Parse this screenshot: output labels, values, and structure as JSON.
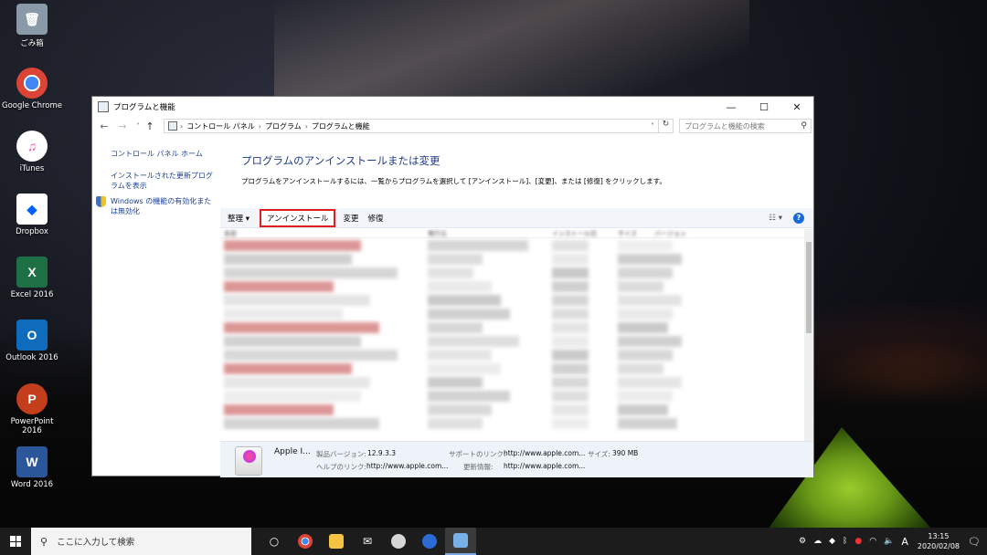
{
  "desktop": {
    "icons": [
      {
        "label": "ごみ箱",
        "color": "#7a8a9a",
        "glyph": "🗑"
      },
      {
        "label": "Google Chrome",
        "color": "#db4437",
        "glyph": "◉"
      },
      {
        "label": "iTunes",
        "color": "#ec4fa0",
        "glyph": "♫"
      },
      {
        "label": "Dropbox",
        "color": "#ffffff",
        "glyph": "◆"
      },
      {
        "label": "Excel 2016",
        "color": "#1d7044",
        "glyph": "X"
      },
      {
        "label": "Outlook 2016",
        "color": "#0f6cbd",
        "glyph": "O"
      },
      {
        "label": "PowerPoint 2016",
        "color": "#c43e1c",
        "glyph": "P"
      },
      {
        "label": "Word 2016",
        "color": "#2b579a",
        "glyph": "W"
      }
    ]
  },
  "window": {
    "title": "プログラムと機能",
    "minimize": "—",
    "maximize": "☐",
    "close": "✕",
    "nav": {
      "back": "←",
      "forward": "→",
      "dropdown": "˅",
      "up": "↑"
    },
    "breadcrumb": [
      "コントロール パネル",
      "プログラム",
      "プログラムと機能"
    ],
    "refresh": "↻",
    "search_placeholder": "プログラムと機能の検索",
    "left_links": {
      "home": "コントロール パネル ホーム",
      "updates": "インストールされた更新プログラムを表示",
      "features": "Windows の機能の有効化または無効化"
    },
    "heading": "プログラムのアンインストールまたは変更",
    "description": "プログラムをアンインストールするには、一覧からプログラムを選択して [アンインストール]、[変更]、または [修復] をクリックします。",
    "toolbar": {
      "organize": "整理 ▾",
      "uninstall": "アンインストール",
      "change": "変更",
      "repair": "修復",
      "view": "☷ ▾",
      "help": "?"
    },
    "columns": [
      "名前",
      "発行元",
      "インストール日",
      "サイズ",
      "バージョン"
    ],
    "details": {
      "app_name": "Apple I...",
      "product_version_label": "製品バージョン:",
      "product_version": "12.9.3.3",
      "help_link_label": "ヘルプのリンク:",
      "help_link": "http://www.apple.com...",
      "support_link_label": "サポートのリンク:",
      "support_link": "http://www.apple.com...",
      "update_info_label": "更新情報:",
      "update_info": "http://www.apple.com...",
      "size_label": "サイズ:",
      "size": "390 MB"
    }
  },
  "taskbar": {
    "search_placeholder": "ここに入力して検索",
    "time": "13:15",
    "date": "2020/02/08",
    "ime": "A",
    "notification_count": "1"
  }
}
